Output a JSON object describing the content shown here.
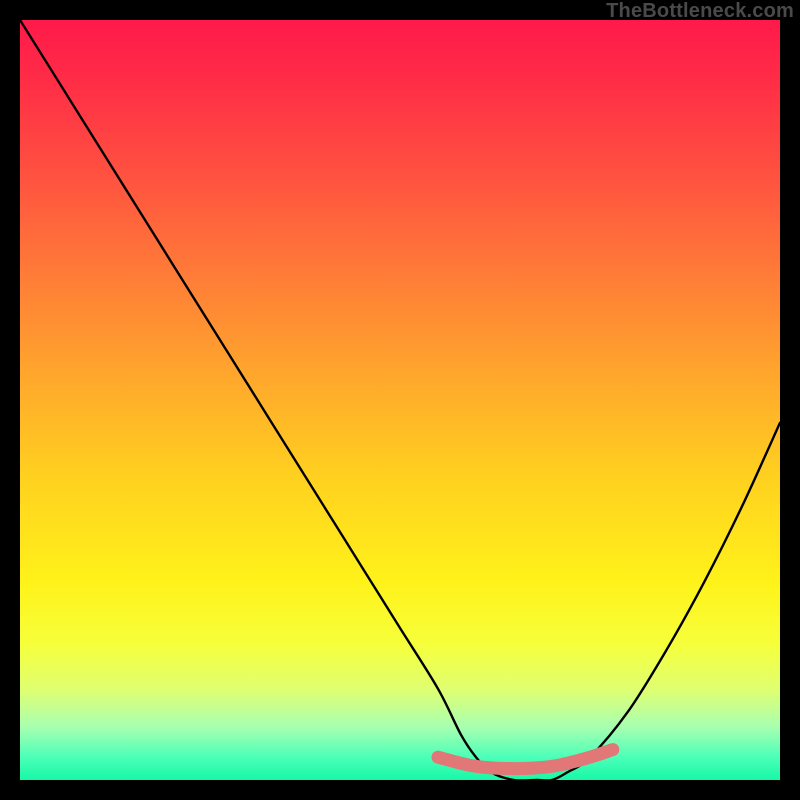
{
  "attribution": "TheBottleneck.com",
  "chart_data": {
    "type": "line",
    "title": "",
    "xlabel": "",
    "ylabel": "",
    "xlim": [
      0,
      100
    ],
    "ylim": [
      0,
      100
    ],
    "series": [
      {
        "name": "bottleneck-curve",
        "x": [
          0,
          5,
          10,
          15,
          20,
          25,
          30,
          35,
          40,
          45,
          50,
          55,
          58,
          60,
          62,
          65,
          68,
          70,
          72,
          75,
          80,
          85,
          90,
          95,
          100
        ],
        "values": [
          100,
          92,
          84,
          76,
          68,
          60,
          52,
          44,
          36,
          28,
          20,
          12,
          6,
          3,
          1,
          0,
          0,
          0,
          1,
          3,
          9,
          17,
          26,
          36,
          47
        ]
      },
      {
        "name": "flat-bottom-marker",
        "x": [
          55,
          58,
          60,
          62,
          65,
          68,
          70,
          72,
          75,
          78
        ],
        "values": [
          3.0,
          2.2,
          1.8,
          1.6,
          1.5,
          1.6,
          1.8,
          2.2,
          3.0,
          4.0
        ]
      }
    ],
    "colors": {
      "curve": "#000000",
      "marker": "#e17776",
      "gradient_top": "#ff1a4a",
      "gradient_bottom": "#18f7a8"
    }
  }
}
